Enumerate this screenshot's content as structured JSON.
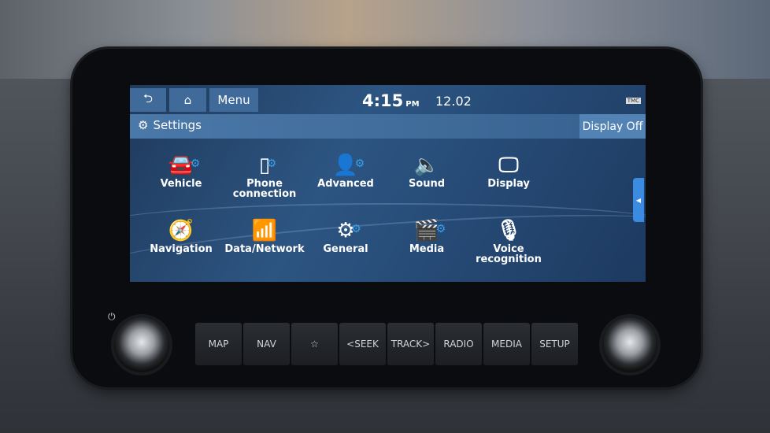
{
  "topbar": {
    "back_icon": "back-arrow-icon",
    "home_icon": "home-icon",
    "menu_label": "Menu",
    "time": "4:15",
    "ampm": "PM",
    "date": "12.02",
    "status": "TMC"
  },
  "titlebar": {
    "title": "Settings",
    "icon": "gear-icon",
    "display_off": "Display Off"
  },
  "tiles": [
    {
      "label": "Vehicle",
      "icon": "car-gear-icon"
    },
    {
      "label": "Phone connection",
      "icon": "phone-bluetooth-icon"
    },
    {
      "label": "Advanced",
      "icon": "user-gear-icon"
    },
    {
      "label": "Sound",
      "icon": "speaker-icon"
    },
    {
      "label": "Display",
      "icon": "monitor-icon"
    },
    {
      "label": "Navigation",
      "icon": "compass-icon"
    },
    {
      "label": "Data/Network",
      "icon": "antenna-icon"
    },
    {
      "label": "General",
      "icon": "gears-icon"
    },
    {
      "label": "Media",
      "icon": "clapperboard-icon"
    },
    {
      "label": "Voice recognition",
      "icon": "microphone-icon"
    }
  ],
  "hard_buttons": [
    "MAP",
    "NAV",
    "☆",
    "<SEEK",
    "TRACK>",
    "RADIO",
    "MEDIA",
    "SETUP"
  ],
  "accent": "#39a0ea"
}
